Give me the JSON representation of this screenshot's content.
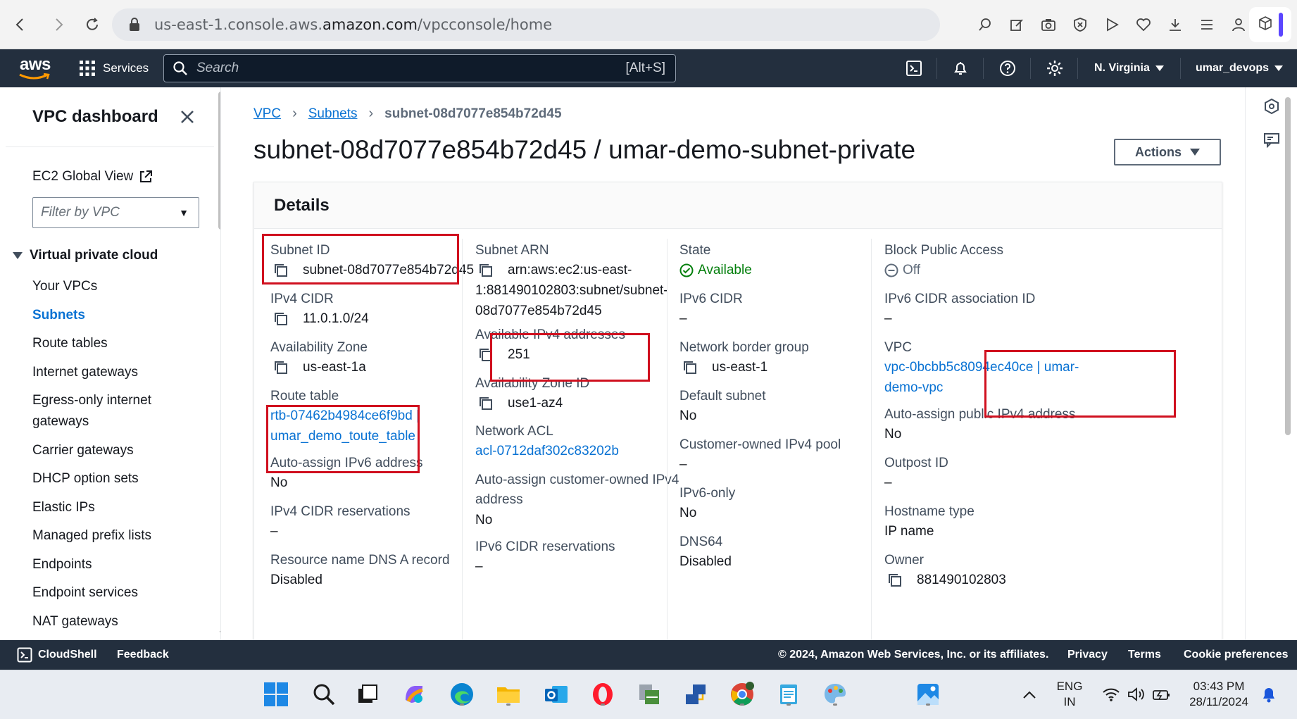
{
  "browser": {
    "url_prefix": "us-east-1.console.aws.",
    "url_domain": "amazon.com",
    "url_path": "/vpcconsole/home"
  },
  "topnav": {
    "logo": "aws",
    "services": "Services",
    "search_placeholder": "Search",
    "search_shortcut": "[Alt+S]",
    "region": "N. Virginia",
    "account": "umar_devops"
  },
  "sidebar": {
    "title": "VPC dashboard",
    "ec2_global_view": "EC2 Global View",
    "filter_placeholder": "Filter by VPC",
    "section": "Virtual private cloud",
    "items": [
      {
        "label": "Your VPCs",
        "active": false
      },
      {
        "label": "Subnets",
        "active": true
      },
      {
        "label": "Route tables",
        "active": false
      },
      {
        "label": "Internet gateways",
        "active": false
      },
      {
        "label": "Egress-only internet gateways",
        "active": false
      },
      {
        "label": "Carrier gateways",
        "active": false
      },
      {
        "label": "DHCP option sets",
        "active": false
      },
      {
        "label": "Elastic IPs",
        "active": false
      },
      {
        "label": "Managed prefix lists",
        "active": false
      },
      {
        "label": "Endpoints",
        "active": false
      },
      {
        "label": "Endpoint services",
        "active": false
      },
      {
        "label": "NAT gateways",
        "active": false
      }
    ]
  },
  "breadcrumb": {
    "vpc": "VPC",
    "subnets": "Subnets",
    "current": "subnet-08d7077e854b72d45"
  },
  "page": {
    "title": "subnet-08d7077e854b72d45 / umar-demo-subnet-private",
    "actions": "Actions"
  },
  "details": {
    "heading": "Details",
    "col1": {
      "subnet_id_label": "Subnet ID",
      "subnet_id_value": "subnet-08d7077e854b72d45",
      "ipv4_cidr_label": "IPv4 CIDR",
      "ipv4_cidr_value": "11.0.1.0/24",
      "az_label": "Availability Zone",
      "az_value": "us-east-1a",
      "route_table_label": "Route table",
      "route_table_value_1": "rtb-07462b4984ce6f9bd |",
      "route_table_value_2": "umar_demo_toute_table",
      "auto_ipv6_label": "Auto-assign IPv6 address",
      "auto_ipv6_value": "No",
      "ipv4_res_label": "IPv4 CIDR reservations",
      "ipv4_res_value": "–",
      "dns_a_label": "Resource name DNS A record",
      "dns_a_value": "Disabled"
    },
    "col2": {
      "arn_label": "Subnet ARN",
      "arn_value_1": "arn:aws:ec2:us-east-",
      "arn_value_2": "1:881490102803:subnet/subnet-",
      "arn_value_3": "08d7077e854b72d45",
      "avail_ipv4_label": "Available IPv4 addresses",
      "avail_ipv4_value": "251",
      "az_id_label": "Availability Zone ID",
      "az_id_value": "use1-az4",
      "nacl_label": "Network ACL",
      "nacl_value": "acl-0712daf302c83202b",
      "auto_cust_label_1": "Auto-assign customer-owned IPv4",
      "auto_cust_label_2": "address",
      "auto_cust_value": "No",
      "ipv6_res_label": "IPv6 CIDR reservations",
      "ipv6_res_value": "–"
    },
    "col3": {
      "state_label": "State",
      "state_value": "Available",
      "ipv6_cidr_label": "IPv6 CIDR",
      "ipv6_cidr_value": "–",
      "nbg_label": "Network border group",
      "nbg_value": "us-east-1",
      "default_label": "Default subnet",
      "default_value": "No",
      "cust_pool_label": "Customer-owned IPv4 pool",
      "cust_pool_value": "–",
      "ipv6_only_label": "IPv6-only",
      "ipv6_only_value": "No",
      "dns64_label": "DNS64",
      "dns64_value": "Disabled"
    },
    "col4": {
      "bpa_label": "Block Public Access",
      "bpa_value": "Off",
      "ipv6_assoc_label": "IPv6 CIDR association ID",
      "ipv6_assoc_value": "–",
      "vpc_label": "VPC",
      "vpc_value_1": "vpc-0bcbb5c8094ec40ce | umar-",
      "vpc_value_2": "demo-vpc",
      "auto_pub_label": "Auto-assign public IPv4 address",
      "auto_pub_value": "No",
      "outpost_label": "Outpost ID",
      "outpost_value": "–",
      "hostname_label": "Hostname type",
      "hostname_value": "IP name",
      "owner_label": "Owner",
      "owner_value": "881490102803"
    }
  },
  "footer": {
    "cloudshell": "CloudShell",
    "feedback": "Feedback",
    "copyright": "© 2024, Amazon Web Services, Inc. or its affiliates.",
    "privacy": "Privacy",
    "terms": "Terms",
    "cookies": "Cookie preferences"
  },
  "taskbar": {
    "lang_1": "ENG",
    "lang_2": "IN",
    "time": "03:43 PM",
    "date": "28/11/2024"
  },
  "colors": {
    "aws_dark": "#232f3e",
    "link": "#0972d3",
    "highlight": "#d0101f",
    "success": "#037f0c"
  }
}
